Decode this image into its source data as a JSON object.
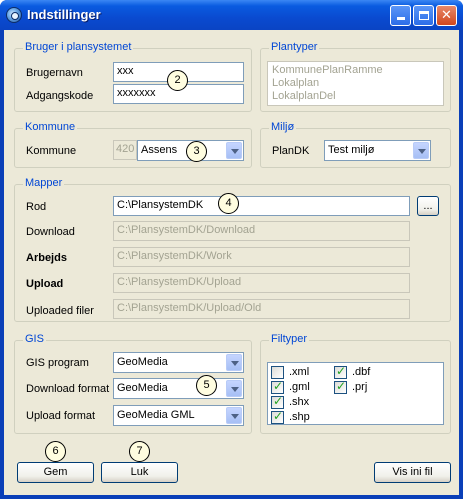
{
  "window": {
    "title": "Indstillinger"
  },
  "bruger": {
    "group_title": "Bruger i plansystemet",
    "brugernavn_label": "Brugernavn",
    "brugernavn_value": "xxx",
    "adgangskode_label": "Adgangskode",
    "adgangskode_value": "xxxxxxx"
  },
  "plantyper": {
    "group_title": "Plantyper",
    "items": [
      "KommunePlanRamme",
      "Lokalplan",
      "LokalplanDel"
    ]
  },
  "kommune": {
    "group_title": "Kommune",
    "label": "Kommune",
    "code": "420",
    "value": "Assens"
  },
  "miljo": {
    "group_title": "Miljø",
    "label": "PlanDK",
    "value": "Test miljø"
  },
  "mapper": {
    "group_title": "Mapper",
    "rod_label": "Rod",
    "rod_value": "C:\\PlansystemDK",
    "browse_label": "...",
    "download_label": "Download",
    "download_value": "C:\\PlansystemDK/Download",
    "arbejds_label": "Arbejds",
    "arbejds_value": "C:\\PlansystemDK/Work",
    "upload_label": "Upload",
    "upload_value": "C:\\PlansystemDK/Upload",
    "uploaded_label": "Uploaded filer",
    "uploaded_value": "C:\\PlansystemDK/Upload/Old"
  },
  "gis": {
    "group_title": "GIS",
    "program_label": "GIS program",
    "program_value": "GeoMedia",
    "download_format_label": "Download format",
    "download_format_value": "GeoMedia",
    "upload_format_label": "Upload format",
    "upload_format_value": "GeoMedia GML"
  },
  "filtyper": {
    "group_title": "Filtyper",
    "items": [
      {
        "label": ".xml",
        "checked": false
      },
      {
        "label": ".dbf",
        "checked": true
      },
      {
        "label": ".gml",
        "checked": true
      },
      {
        "label": ".prj",
        "checked": true
      },
      {
        "label": ".shx",
        "checked": true
      },
      {
        "label": ".shp",
        "checked": true
      }
    ]
  },
  "buttons": {
    "gem": "Gem",
    "luk": "Luk",
    "vis_ini": "Vis ini fil"
  },
  "callouts": {
    "c2": "2",
    "c3": "3",
    "c4": "4",
    "c5": "5",
    "c6": "6",
    "c7": "7"
  }
}
